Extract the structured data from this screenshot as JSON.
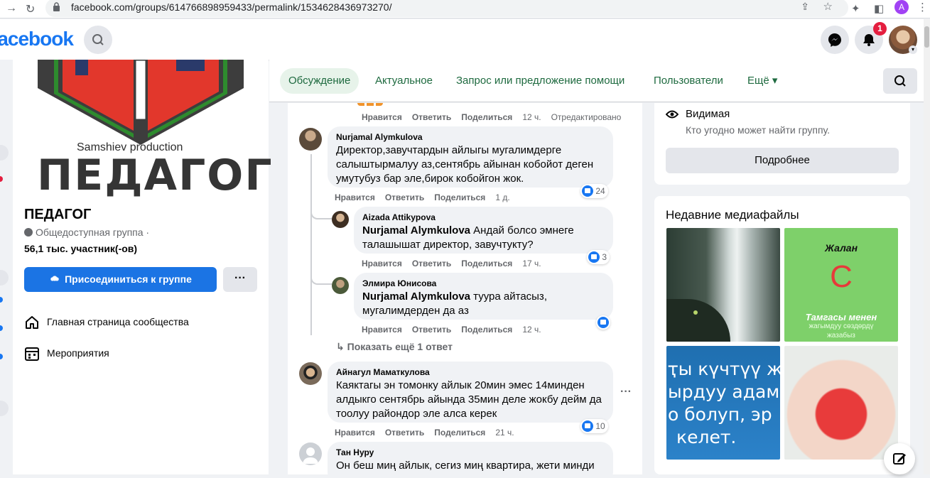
{
  "browser": {
    "back_icon": "arrow-right-icon",
    "url": "facebook.com/groups/614766898959433/permalink/1534628436973270/",
    "profile_initial": "A"
  },
  "header": {
    "logo": "facebook",
    "notification_count": "1"
  },
  "group": {
    "cover_caption": "Samshiev production",
    "cover_title": "ПЕДАГОГ",
    "name": "ПЕДАГОГ",
    "privacy": "Общедоступная группа ·",
    "members": "56,1 тыс. участник(-ов)",
    "join_label": "Присоединиться к группе",
    "more_label": "···",
    "nav": [
      {
        "label": "Главная страница сообщества"
      },
      {
        "label": "Мероприятия"
      }
    ]
  },
  "tabs": [
    {
      "label": "Обсуждение"
    },
    {
      "label": "Актуальное"
    },
    {
      "label": "Запрос или предложение помощи"
    },
    {
      "label": "Пользователи"
    },
    {
      "label": "Ещё ▾"
    }
  ],
  "feed": {
    "top_actions": {
      "like": "Нравится",
      "reply": "Ответить",
      "share": "Поделиться",
      "time": "12 ч.",
      "edited": "Отредактировано"
    },
    "comments": [
      {
        "author": "Nurjamal Alymkulova",
        "text": "Директор,завучтардын айлыгы мугалимдерге салыштырмалуу аз,сентябрь айынан кобойот деген умутубуз бар эле,бирок кобойгон жок.",
        "like": "Нравится",
        "reply": "Ответить",
        "share": "Поделиться",
        "time": "1 д.",
        "reactions": "24"
      },
      {
        "author": "Aizada Attikypova",
        "mention": "Nurjamal Alymkulova",
        "text": " Андай болсо эмнеге талашышат директор, завучтукту?",
        "like": "Нравится",
        "reply": "Ответить",
        "share": "Поделиться",
        "time": "17 ч.",
        "reactions": "3"
      },
      {
        "author": "Элмира Юнисова",
        "mention": "Nurjamal Alymkulova",
        "text": " туура айтасыз, мугалимдерден да аз",
        "like": "Нравится",
        "reply": "Ответить",
        "share": "Поделиться",
        "time": "12 ч."
      },
      {
        "author": "Айнагул Маматкулова",
        "text": "Каяктагы эн томонку айлык 20мин эмес 14минден алдыкго сентябрь айында 35мин деле жокбу дейм да тоолуу райондор эле алса керек",
        "like": "Нравится",
        "reply": "Ответить",
        "share": "Поделиться",
        "time": "21 ч.",
        "reactions": "10"
      },
      {
        "author": "Тан Нуру",
        "text": "Он беш миң айлык, сегиз миң квартира, жети минди"
      }
    ],
    "more_replies": "Показать ещё 1 ответ",
    "comment_menu": "···"
  },
  "about": {
    "visibility_title": "Видимая",
    "visibility_desc": "Кто угодно может найти группу.",
    "details_btn": "Подробнее"
  },
  "media": {
    "title": "Недавние медиафайлы",
    "items": [
      {
        "kind": "waterfall-photo"
      },
      {
        "kind": "letter-card",
        "top": "Жалан",
        "letter": "С",
        "bottom": "Тамгасы менен",
        "bottom2": "жагымдуу сөздөрдү",
        "bottom3": "жазабыз"
      },
      {
        "kind": "text-card",
        "lines": [
          "ҭы күчтүү ж",
          "ырдуу адам",
          "о болуп, эр",
          "келет."
        ]
      },
      {
        "kind": "heart-photo"
      }
    ]
  }
}
